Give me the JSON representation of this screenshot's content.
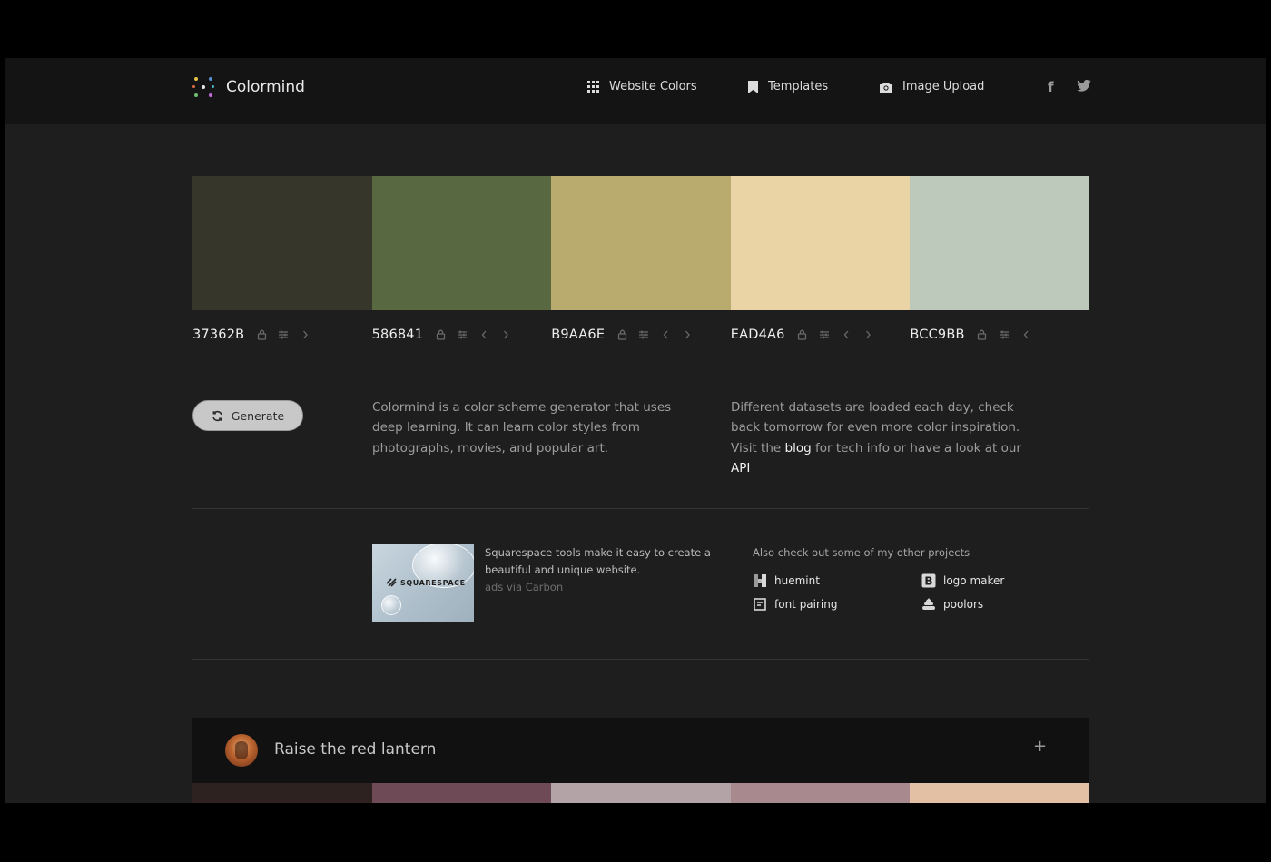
{
  "header": {
    "brand": "Colormind",
    "nav": [
      {
        "label": "Website Colors",
        "icon": "grid-icon"
      },
      {
        "label": "Templates",
        "icon": "bookmark-icon"
      },
      {
        "label": "Image Upload",
        "icon": "camera-icon"
      }
    ],
    "social": [
      {
        "icon": "facebook-icon",
        "glyph": "f"
      },
      {
        "icon": "twitter-icon",
        "glyph": "🐦"
      }
    ]
  },
  "palette": {
    "colors": [
      {
        "hex": "37362B",
        "color": "#37362B",
        "prev": false,
        "next": true
      },
      {
        "hex": "586841",
        "color": "#586841",
        "prev": true,
        "next": true
      },
      {
        "hex": "B9AA6E",
        "color": "#B9AA6E",
        "prev": true,
        "next": true
      },
      {
        "hex": "EAD4A6",
        "color": "#EAD4A6",
        "prev": true,
        "next": true
      },
      {
        "hex": "BCC9BB",
        "color": "#BCC9BB",
        "prev": true,
        "next": false
      }
    ]
  },
  "generate": {
    "label": "Generate"
  },
  "description_left": "Colormind is a color scheme generator that uses deep learning. It can learn color styles from photographs, movies, and popular art.",
  "description_right": {
    "text_before": "Different datasets are loaded each day, check back tomorrow for even more color inspiration. Visit the",
    "blog_link": "blog",
    "text_middle": "for tech info or have a look at our",
    "api_link": "API"
  },
  "ad": {
    "brand": "SQUARESPACE",
    "text": "Squarespace tools make it easy to create a beautiful and unique website.",
    "via": "ads via Carbon"
  },
  "projects": {
    "title": "Also check out some of my other projects",
    "items": [
      {
        "label": "huemint",
        "icon": "huemint-icon"
      },
      {
        "label": "logo maker",
        "icon": "logo-maker-icon"
      },
      {
        "label": "font pairing",
        "icon": "font-pairing-icon"
      },
      {
        "label": "poolors",
        "icon": "poolors-icon"
      }
    ]
  },
  "featured": {
    "title": "Raise the red lantern",
    "plus": "+",
    "colors": [
      "#2e2220",
      "#6e4a56",
      "#b3a2a6",
      "#a8898e",
      "#e3bfa3"
    ]
  }
}
